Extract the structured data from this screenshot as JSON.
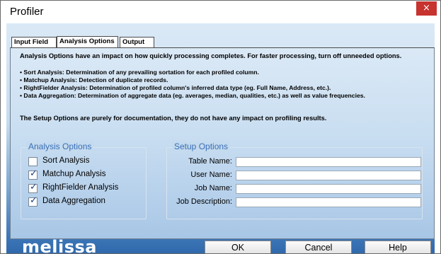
{
  "window": {
    "title": "Profiler",
    "close_glyph": "×"
  },
  "tabs": [
    {
      "label": "Input Field",
      "active": false
    },
    {
      "label": "Analysis Options",
      "active": true
    },
    {
      "label": "Output",
      "active": false
    }
  ],
  "panel": {
    "intro": "Analysis Options have an impact on how quickly processing completes. For faster processing, turn off unneeded options.",
    "bullets": [
      "• Sort Analysis: Determination of any prevailing sortation for each profiled column.",
      "• Matchup Analysis: Detection of duplicate records.",
      "• RightFielder Analysis: Determination of profiled column's inferred data type (eg. Full Name, Address, etc.).",
      "• Data Aggregation: Determination of aggregate data (eg. averages, median, qualities, etc.) as well as value frequencies."
    ],
    "setup_note": "The Setup Options are purely for documentation, they do not have any impact on profiling results."
  },
  "analysis_options": {
    "legend": "Analysis Options",
    "items": [
      {
        "label": "Sort Analysis",
        "checked": false
      },
      {
        "label": "Matchup Analysis",
        "checked": true
      },
      {
        "label": "RightFielder Analysis",
        "checked": true
      },
      {
        "label": "Data Aggregation",
        "checked": true
      }
    ]
  },
  "setup_options": {
    "legend": "Setup Options",
    "fields": [
      {
        "label": "Table Name:",
        "value": ""
      },
      {
        "label": "User Name:",
        "value": ""
      },
      {
        "label": "Job Name:",
        "value": ""
      },
      {
        "label": "Job Description:",
        "value": ""
      }
    ]
  },
  "footer": {
    "logo": "melissa",
    "ok_label": "OK",
    "cancel_label": "Cancel",
    "help_label": "Help"
  },
  "colors": {
    "close_button": "#c7332f",
    "legend_text": "#3a6fb6",
    "checkmark": "#1d3f78"
  }
}
